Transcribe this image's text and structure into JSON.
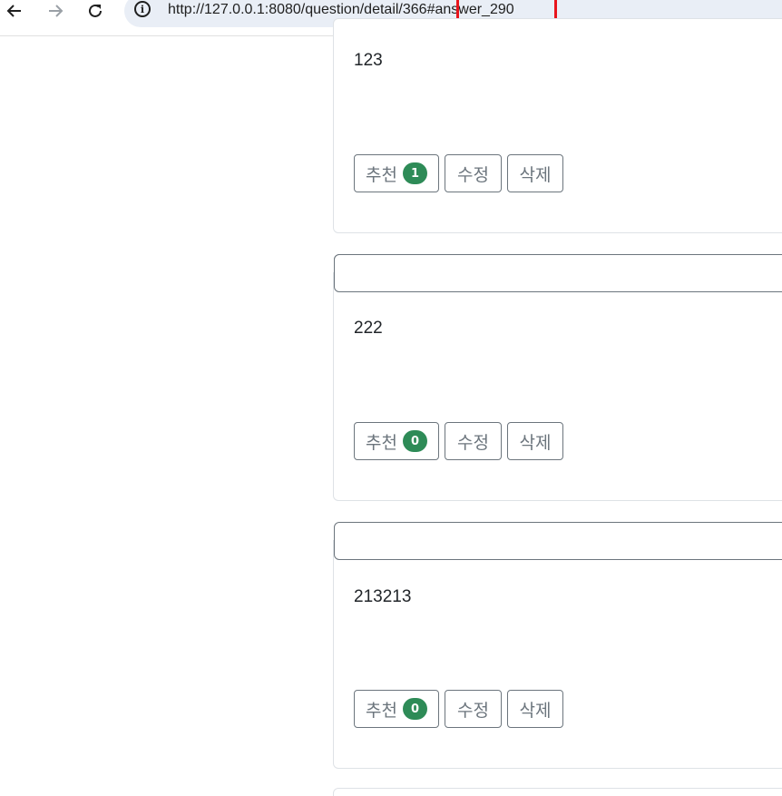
{
  "browser": {
    "url": "http://127.0.0.1:8080/question/detail/366#answer_290",
    "highlighted_fragment": "#answer_290",
    "highlight_color": "#e8141c"
  },
  "colors": {
    "badge": "#2e8b57",
    "button_border": "#6c757d"
  },
  "answers": [
    {
      "content": "123",
      "vote_label": "추천",
      "vote_count": "1",
      "edit_label": "수정",
      "delete_label": "삭제"
    },
    {
      "content": "222",
      "vote_label": "추천",
      "vote_count": "0",
      "edit_label": "수정",
      "delete_label": "삭제"
    },
    {
      "content": "213213",
      "vote_label": "추천",
      "vote_count": "0",
      "edit_label": "수정",
      "delete_label": "삭제"
    }
  ]
}
